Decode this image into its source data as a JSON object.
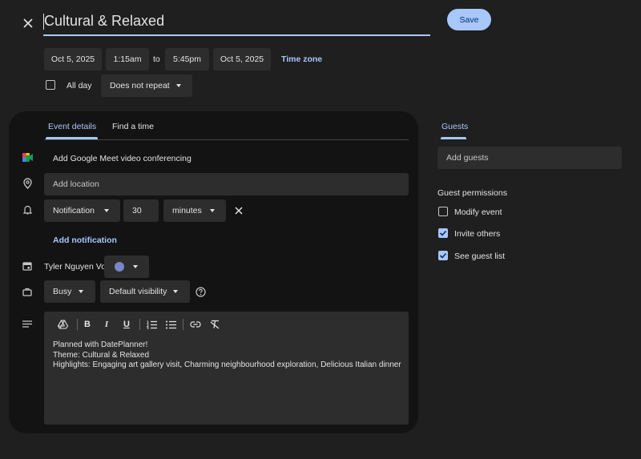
{
  "header": {
    "title": "Cultural & Relaxed",
    "save_label": "Save"
  },
  "datetime": {
    "start_date": "Oct 5, 2025",
    "start_time": "1:15am",
    "to_label": "to",
    "end_time": "5:45pm",
    "end_date": "Oct 5, 2025",
    "timezone_label": "Time zone",
    "all_day_label": "All day",
    "all_day_checked": false,
    "repeat_value": "Does not repeat"
  },
  "tabs": [
    {
      "label": "Event details",
      "active": true
    },
    {
      "label": "Find a time",
      "active": false
    }
  ],
  "details": {
    "meet_label": "Add Google Meet video conferencing",
    "location_placeholder": "Add location",
    "notification_type": "Notification",
    "notification_value": "30",
    "notification_unit": "minutes",
    "add_notification_label": "Add notification",
    "calendar_owner": "Tyler Nguyen Vo",
    "calendar_color": "#7986cb",
    "busy_value": "Busy",
    "visibility_value": "Default visibility"
  },
  "description": {
    "line1": "Planned with DatePlanner!",
    "line2": "Theme: Cultural & Relaxed",
    "line3": "Highlights: Engaging art gallery visit, Charming neighbourhood exploration, Delicious Italian dinner"
  },
  "guests": {
    "tab_label": "Guests",
    "add_placeholder": "Add guests",
    "permissions_title": "Guest permissions",
    "permissions": [
      {
        "label": "Modify event",
        "checked": false
      },
      {
        "label": "Invite others",
        "checked": true
      },
      {
        "label": "See guest list",
        "checked": true
      }
    ]
  },
  "colors": {
    "accent": "#a8c7fa",
    "background": "#1f1f1f",
    "panel": "#131314",
    "field": "#2d2d2d"
  }
}
